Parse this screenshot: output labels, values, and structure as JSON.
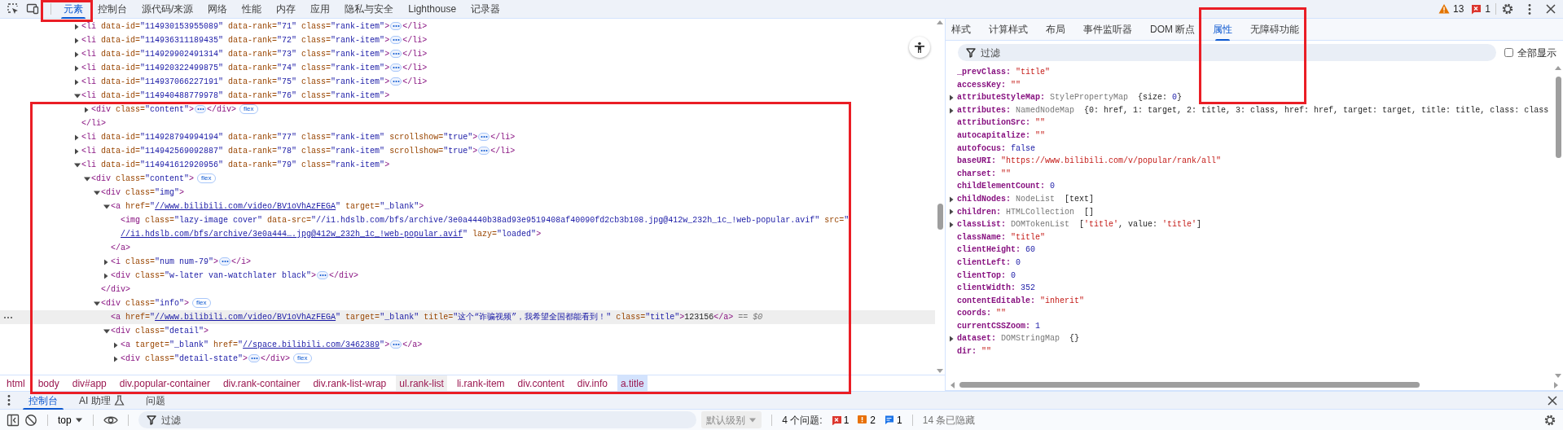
{
  "main_tabs": [
    {
      "label": "元素",
      "selected": true
    },
    {
      "label": "控制台",
      "selected": false
    },
    {
      "label": "源代码/来源",
      "selected": false
    },
    {
      "label": "网络",
      "selected": false
    },
    {
      "label": "性能",
      "selected": false
    },
    {
      "label": "内存",
      "selected": false
    },
    {
      "label": "应用",
      "selected": false
    },
    {
      "label": "隐私与安全",
      "selected": false
    },
    {
      "label": "Lighthouse",
      "selected": false
    },
    {
      "label": "记录器",
      "selected": false
    }
  ],
  "top_counts": {
    "warnings": "13",
    "errors": "1"
  },
  "dom_tree": [
    {
      "selected": false,
      "expanded": false,
      "tokens": [
        {
          "kind": "tag",
          "text": "<li"
        },
        {
          "kind": "attr",
          "text": " data-id="
        },
        {
          "kind": "value",
          "text": "\"114930153955089\""
        },
        {
          "kind": "attr",
          "text": " data-rank="
        },
        {
          "kind": "value",
          "text": "\"71\""
        },
        {
          "kind": "attr",
          "text": " class="
        },
        {
          "kind": "value",
          "text": "\"rank-item\""
        },
        {
          "kind": "tag",
          "text": ">"
        },
        {
          "kind": "more"
        },
        {
          "kind": "tag",
          "text": "</li>"
        }
      ]
    },
    {
      "selected": false,
      "expanded": false,
      "tokens": [
        {
          "kind": "tag",
          "text": "<li"
        },
        {
          "kind": "attr",
          "text": " data-id="
        },
        {
          "kind": "value",
          "text": "\"114936311189435\""
        },
        {
          "kind": "attr",
          "text": " data-rank="
        },
        {
          "kind": "value",
          "text": "\"72\""
        },
        {
          "kind": "attr",
          "text": " class="
        },
        {
          "kind": "value",
          "text": "\"rank-item\""
        },
        {
          "kind": "tag",
          "text": ">"
        },
        {
          "kind": "more"
        },
        {
          "kind": "tag",
          "text": "</li>"
        }
      ]
    },
    {
      "selected": false,
      "expanded": false,
      "tokens": [
        {
          "kind": "tag",
          "text": "<li"
        },
        {
          "kind": "attr",
          "text": " data-id="
        },
        {
          "kind": "value",
          "text": "\"114929902491314\""
        },
        {
          "kind": "attr",
          "text": " data-rank="
        },
        {
          "kind": "value",
          "text": "\"73\""
        },
        {
          "kind": "attr",
          "text": " class="
        },
        {
          "kind": "value",
          "text": "\"rank-item\""
        },
        {
          "kind": "tag",
          "text": ">"
        },
        {
          "kind": "more"
        },
        {
          "kind": "tag",
          "text": "</li>"
        }
      ]
    },
    {
      "selected": false,
      "expanded": false,
      "tokens": [
        {
          "kind": "tag",
          "text": "<li"
        },
        {
          "kind": "attr",
          "text": " data-id="
        },
        {
          "kind": "value",
          "text": "\"114920322499875\""
        },
        {
          "kind": "attr",
          "text": " data-rank="
        },
        {
          "kind": "value",
          "text": "\"74\""
        },
        {
          "kind": "attr",
          "text": " class="
        },
        {
          "kind": "value",
          "text": "\"rank-item\""
        },
        {
          "kind": "tag",
          "text": ">"
        },
        {
          "kind": "more"
        },
        {
          "kind": "tag",
          "text": "</li>"
        }
      ]
    },
    {
      "selected": false,
      "expanded": false,
      "tokens": [
        {
          "kind": "tag",
          "text": "<li"
        },
        {
          "kind": "attr",
          "text": " data-id="
        },
        {
          "kind": "value",
          "text": "\"114937066227191\""
        },
        {
          "kind": "attr",
          "text": " data-rank="
        },
        {
          "kind": "value",
          "text": "\"75\""
        },
        {
          "kind": "attr",
          "text": " class="
        },
        {
          "kind": "value",
          "text": "\"rank-item\""
        },
        {
          "kind": "tag",
          "text": ">"
        },
        {
          "kind": "more"
        },
        {
          "kind": "tag",
          "text": "</li>"
        }
      ]
    },
    {
      "selected": false,
      "expanded": true,
      "tokens": [
        {
          "kind": "tag",
          "text": "<li"
        },
        {
          "kind": "attr",
          "text": " data-id="
        },
        {
          "kind": "value",
          "text": "\"114940488779978\""
        },
        {
          "kind": "attr",
          "text": " data-rank="
        },
        {
          "kind": "value",
          "text": "\"76\""
        },
        {
          "kind": "attr",
          "text": " class="
        },
        {
          "kind": "value",
          "text": "\"rank-item\""
        },
        {
          "kind": "tag",
          "text": ">"
        }
      ],
      "close": [
        {
          "kind": "tag",
          "text": "</li>"
        }
      ],
      "children": [
        {
          "selected": false,
          "expanded": false,
          "tokens": [
            {
              "kind": "tag",
              "text": "<div"
            },
            {
              "kind": "attr",
              "text": " class="
            },
            {
              "kind": "value",
              "text": "\"content\""
            },
            {
              "kind": "tag",
              "text": ">"
            },
            {
              "kind": "more"
            },
            {
              "kind": "tag",
              "text": "</div>"
            },
            {
              "kind": "flex",
              "text": "flex"
            }
          ]
        }
      ]
    },
    {
      "selected": false,
      "expanded": false,
      "tokens": [
        {
          "kind": "tag",
          "text": "<li"
        },
        {
          "kind": "attr",
          "text": " data-id="
        },
        {
          "kind": "value",
          "text": "\"114928794994194\""
        },
        {
          "kind": "attr",
          "text": " data-rank="
        },
        {
          "kind": "value",
          "text": "\"77\""
        },
        {
          "kind": "attr",
          "text": " class="
        },
        {
          "kind": "value",
          "text": "\"rank-item\""
        },
        {
          "kind": "attr",
          "text": " scrollshow="
        },
        {
          "kind": "value",
          "text": "\"true\""
        },
        {
          "kind": "tag",
          "text": ">"
        },
        {
          "kind": "more"
        },
        {
          "kind": "tag",
          "text": "</li>"
        }
      ]
    },
    {
      "selected": false,
      "expanded": false,
      "tokens": [
        {
          "kind": "tag",
          "text": "<li"
        },
        {
          "kind": "attr",
          "text": " data-id="
        },
        {
          "kind": "value",
          "text": "\"114942569092887\""
        },
        {
          "kind": "attr",
          "text": " data-rank="
        },
        {
          "kind": "value",
          "text": "\"78\""
        },
        {
          "kind": "attr",
          "text": " class="
        },
        {
          "kind": "value",
          "text": "\"rank-item\""
        },
        {
          "kind": "attr",
          "text": " scrollshow="
        },
        {
          "kind": "value",
          "text": "\"true\""
        },
        {
          "kind": "tag",
          "text": ">"
        },
        {
          "kind": "more"
        },
        {
          "kind": "tag",
          "text": "</li>"
        }
      ]
    },
    {
      "selected": false,
      "expanded": true,
      "tokens": [
        {
          "kind": "tag",
          "text": "<li"
        },
        {
          "kind": "attr",
          "text": " data-id="
        },
        {
          "kind": "value",
          "text": "\"114941612920956\""
        },
        {
          "kind": "attr",
          "text": " data-rank="
        },
        {
          "kind": "value",
          "text": "\"79\""
        },
        {
          "kind": "attr",
          "text": " class="
        },
        {
          "kind": "value",
          "text": "\"rank-item\""
        },
        {
          "kind": "tag",
          "text": ">"
        }
      ],
      "children": [
        {
          "selected": false,
          "expanded": true,
          "tokens": [
            {
              "kind": "tag",
              "text": "<div"
            },
            {
              "kind": "attr",
              "text": " class="
            },
            {
              "kind": "value",
              "text": "\"content\""
            },
            {
              "kind": "tag",
              "text": ">"
            },
            {
              "kind": "flex",
              "text": "flex"
            }
          ],
          "children": [
            {
              "selected": false,
              "expanded": true,
              "tokens": [
                {
                  "kind": "tag",
                  "text": "<div"
                },
                {
                  "kind": "attr",
                  "text": " class="
                },
                {
                  "kind": "value",
                  "text": "\"img\""
                },
                {
                  "kind": "tag",
                  "text": ">"
                }
              ],
              "close": [
                {
                  "kind": "tag",
                  "text": "</div>"
                }
              ],
              "children": [
                {
                  "selected": false,
                  "expanded": true,
                  "tokens": [
                    {
                      "kind": "tag",
                      "text": "<a"
                    },
                    {
                      "kind": "attr",
                      "text": " href="
                    },
                    {
                      "kind": "value",
                      "text": "\""
                    },
                    {
                      "kind": "link",
                      "text": "//www.bilibili.com/video/BV1oVhAzFEGA"
                    },
                    {
                      "kind": "value",
                      "text": "\""
                    },
                    {
                      "kind": "attr",
                      "text": " target="
                    },
                    {
                      "kind": "value",
                      "text": "\"_blank\""
                    },
                    {
                      "kind": "tag",
                      "text": ">"
                    }
                  ],
                  "close": [
                    {
                      "kind": "tag",
                      "text": "</a>"
                    }
                  ],
                  "children": [
                    {
                      "selected": false,
                      "tokens": [
                        {
                          "kind": "tag",
                          "text": "<img"
                        },
                        {
                          "kind": "attr",
                          "text": " class="
                        },
                        {
                          "kind": "value",
                          "text": "\"lazy-image cover\""
                        },
                        {
                          "kind": "attr",
                          "text": " data-src="
                        },
                        {
                          "kind": "value",
                          "text": "\"//i1.hdslb.com/bfs/archive/3e0a4440b38ad93e9519408af40090fd2cb3b108.jpg@412w_232h_1c_!web-popular.avif\""
                        },
                        {
                          "kind": "attr",
                          "text": " src="
                        },
                        {
                          "kind": "value",
                          "text": "\""
                        },
                        {
                          "kind": "link",
                          "text": "//i1.hdslb.com/bfs/archive/3e0a444….jpg@412w_232h_1c_!web-popular.avif"
                        },
                        {
                          "kind": "value",
                          "text": "\""
                        },
                        {
                          "kind": "attr",
                          "text": " lazy="
                        },
                        {
                          "kind": "value",
                          "text": "\"loaded\""
                        },
                        {
                          "kind": "tag",
                          "text": ">"
                        }
                      ]
                    }
                  ]
                },
                {
                  "selected": false,
                  "expanded": false,
                  "tokens": [
                    {
                      "kind": "tag",
                      "text": "<i"
                    },
                    {
                      "kind": "attr",
                      "text": " class="
                    },
                    {
                      "kind": "value",
                      "text": "\"num num-79\""
                    },
                    {
                      "kind": "tag",
                      "text": ">"
                    },
                    {
                      "kind": "more"
                    },
                    {
                      "kind": "tag",
                      "text": "</i>"
                    }
                  ]
                },
                {
                  "selected": false,
                  "expanded": false,
                  "tokens": [
                    {
                      "kind": "tag",
                      "text": "<div"
                    },
                    {
                      "kind": "attr",
                      "text": " class="
                    },
                    {
                      "kind": "value",
                      "text": "\"w-later van-watchlater black\""
                    },
                    {
                      "kind": "tag",
                      "text": ">"
                    },
                    {
                      "kind": "more"
                    },
                    {
                      "kind": "tag",
                      "text": "</div>"
                    }
                  ]
                }
              ]
            },
            {
              "selected": false,
              "expanded": true,
              "tokens": [
                {
                  "kind": "tag",
                  "text": "<div"
                },
                {
                  "kind": "attr",
                  "text": " class="
                },
                {
                  "kind": "value",
                  "text": "\"info\""
                },
                {
                  "kind": "tag",
                  "text": ">"
                },
                {
                  "kind": "flex",
                  "text": "flex"
                }
              ],
              "children": [
                {
                  "selected": true,
                  "tokens": [
                    {
                      "kind": "tag",
                      "text": "<a"
                    },
                    {
                      "kind": "attr",
                      "text": " href="
                    },
                    {
                      "kind": "value",
                      "text": "\""
                    },
                    {
                      "kind": "link",
                      "text": "//www.bilibili.com/video/BV1oVhAzFEGA"
                    },
                    {
                      "kind": "value",
                      "text": "\""
                    },
                    {
                      "kind": "attr",
                      "text": " target="
                    },
                    {
                      "kind": "value",
                      "text": "\"_blank\""
                    },
                    {
                      "kind": "attr",
                      "text": " title="
                    },
                    {
                      "kind": "value",
                      "text": "\"这个“诈骗视频”，我希望全国都能看到！\""
                    },
                    {
                      "kind": "attr",
                      "text": " class="
                    },
                    {
                      "kind": "value",
                      "text": "\"title\""
                    },
                    {
                      "kind": "tag",
                      "text": ">"
                    },
                    {
                      "kind": "text",
                      "text": "123156"
                    },
                    {
                      "kind": "tag",
                      "text": "</a>"
                    },
                    {
                      "kind": "note",
                      "text": " == $0"
                    }
                  ]
                },
                {
                  "selected": false,
                  "expanded": true,
                  "tokens": [
                    {
                      "kind": "tag",
                      "text": "<div"
                    },
                    {
                      "kind": "attr",
                      "text": " class="
                    },
                    {
                      "kind": "value",
                      "text": "\"detail\""
                    },
                    {
                      "kind": "tag",
                      "text": ">"
                    }
                  ],
                  "children": [
                    {
                      "selected": false,
                      "expanded": false,
                      "tokens": [
                        {
                          "kind": "tag",
                          "text": "<a"
                        },
                        {
                          "kind": "attr",
                          "text": " target="
                        },
                        {
                          "kind": "value",
                          "text": "\"_blank\""
                        },
                        {
                          "kind": "attr",
                          "text": " href="
                        },
                        {
                          "kind": "value",
                          "text": "\""
                        },
                        {
                          "kind": "link",
                          "text": "//space.bilibili.com/3462389"
                        },
                        {
                          "kind": "value",
                          "text": "\""
                        },
                        {
                          "kind": "tag",
                          "text": ">"
                        },
                        {
                          "kind": "more"
                        },
                        {
                          "kind": "tag",
                          "text": "</a>"
                        }
                      ]
                    },
                    {
                      "selected": false,
                      "expanded": false,
                      "tokens": [
                        {
                          "kind": "tag",
                          "text": "<div"
                        },
                        {
                          "kind": "attr",
                          "text": " class="
                        },
                        {
                          "kind": "value",
                          "text": "\"detail-state\""
                        },
                        {
                          "kind": "tag",
                          "text": ">"
                        },
                        {
                          "kind": "more"
                        },
                        {
                          "kind": "tag",
                          "text": "</div>"
                        },
                        {
                          "kind": "flex",
                          "text": "flex"
                        }
                      ]
                    }
                  ]
                }
              ]
            }
          ]
        }
      ]
    }
  ],
  "breadcrumbs": [
    {
      "label": "html",
      "selected": false,
      "hovered": false
    },
    {
      "label": "body",
      "selected": false,
      "hovered": false
    },
    {
      "label": "div#app",
      "selected": false,
      "hovered": false
    },
    {
      "label": "div.popular-container",
      "selected": false,
      "hovered": false
    },
    {
      "label": "div.rank-container",
      "selected": false,
      "hovered": false
    },
    {
      "label": "div.rank-list-wrap",
      "selected": false,
      "hovered": false
    },
    {
      "label": "ul.rank-list",
      "selected": false,
      "hovered": true
    },
    {
      "label": "li.rank-item",
      "selected": false,
      "hovered": false
    },
    {
      "label": "div.content",
      "selected": false,
      "hovered": false
    },
    {
      "label": "div.info",
      "selected": false,
      "hovered": false
    },
    {
      "label": "a.title",
      "selected": true,
      "hovered": false
    }
  ],
  "side_tabs": [
    {
      "label": "样式",
      "selected": false
    },
    {
      "label": "计算样式",
      "selected": false
    },
    {
      "label": "布局",
      "selected": false
    },
    {
      "label": "事件监听器",
      "selected": false
    },
    {
      "label": "DOM 断点",
      "selected": false
    },
    {
      "label": "属性",
      "selected": true
    },
    {
      "label": "无障碍功能",
      "selected": false
    }
  ],
  "side_filter": {
    "placeholder": "过滤"
  },
  "show_all": {
    "label": "全部显示",
    "checked": false
  },
  "properties": [
    {
      "name": "_prevClass:",
      "expandable": false,
      "value": [
        {
          "kind": "string",
          "text": "\"title\""
        }
      ]
    },
    {
      "name": "accessKey:",
      "expandable": false,
      "value": [
        {
          "kind": "string",
          "text": "\"\""
        }
      ]
    },
    {
      "name": "attributeStyleMap:",
      "expandable": true,
      "value": [
        {
          "kind": "type",
          "text": "StylePropertyMap"
        },
        {
          "kind": "text",
          "text": "  {size: "
        },
        {
          "kind": "number",
          "text": "0"
        },
        {
          "kind": "text",
          "text": "}"
        }
      ]
    },
    {
      "name": "attributes:",
      "expandable": true,
      "value": [
        {
          "kind": "type",
          "text": "NamedNodeMap"
        },
        {
          "kind": "text",
          "text": "  {0: href, 1: target, 2: title, 3: class, href: href, target: target, title: title, class: class"
        }
      ]
    },
    {
      "name": "attributionSrc:",
      "expandable": false,
      "value": [
        {
          "kind": "string",
          "text": "\"\""
        }
      ]
    },
    {
      "name": "autocapitalize:",
      "expandable": false,
      "value": [
        {
          "kind": "string",
          "text": "\"\""
        }
      ]
    },
    {
      "name": "autofocus:",
      "expandable": false,
      "value": [
        {
          "kind": "number",
          "text": "false"
        }
      ]
    },
    {
      "name": "baseURI:",
      "expandable": false,
      "value": [
        {
          "kind": "string",
          "text": "\"https://www.bilibili.com/v/popular/rank/all\""
        }
      ]
    },
    {
      "name": "charset:",
      "expandable": false,
      "value": [
        {
          "kind": "string",
          "text": "\"\""
        }
      ]
    },
    {
      "name": "childElementCount:",
      "expandable": false,
      "value": [
        {
          "kind": "number",
          "text": "0"
        }
      ]
    },
    {
      "name": "childNodes:",
      "expandable": true,
      "value": [
        {
          "kind": "type",
          "text": "NodeList"
        },
        {
          "kind": "text",
          "text": "  [text]"
        }
      ]
    },
    {
      "name": "children:",
      "expandable": true,
      "value": [
        {
          "kind": "type",
          "text": "HTMLCollection"
        },
        {
          "kind": "text",
          "text": "  []"
        }
      ]
    },
    {
      "name": "classList:",
      "expandable": true,
      "value": [
        {
          "kind": "type",
          "text": "DOMTokenList"
        },
        {
          "kind": "text",
          "text": "  ["
        },
        {
          "kind": "string",
          "text": "'title'"
        },
        {
          "kind": "text",
          "text": ", value: "
        },
        {
          "kind": "string",
          "text": "'title'"
        },
        {
          "kind": "text",
          "text": "]"
        }
      ]
    },
    {
      "name": "className:",
      "expandable": false,
      "value": [
        {
          "kind": "string",
          "text": "\"title\""
        }
      ]
    },
    {
      "name": "clientHeight:",
      "expandable": false,
      "value": [
        {
          "kind": "number",
          "text": "60"
        }
      ]
    },
    {
      "name": "clientLeft:",
      "expandable": false,
      "value": [
        {
          "kind": "number",
          "text": "0"
        }
      ]
    },
    {
      "name": "clientTop:",
      "expandable": false,
      "value": [
        {
          "kind": "number",
          "text": "0"
        }
      ]
    },
    {
      "name": "clientWidth:",
      "expandable": false,
      "value": [
        {
          "kind": "number",
          "text": "352"
        }
      ]
    },
    {
      "name": "contentEditable:",
      "expandable": false,
      "value": [
        {
          "kind": "string",
          "text": "\"inherit\""
        }
      ]
    },
    {
      "name": "coords:",
      "expandable": false,
      "value": [
        {
          "kind": "string",
          "text": "\"\""
        }
      ]
    },
    {
      "name": "currentCSSZoom:",
      "expandable": false,
      "value": [
        {
          "kind": "number",
          "text": "1"
        }
      ]
    },
    {
      "name": "dataset:",
      "expandable": true,
      "value": [
        {
          "kind": "type",
          "text": "DOMStringMap"
        },
        {
          "kind": "text",
          "text": "  {}"
        }
      ]
    },
    {
      "name": "dir:",
      "expandable": false,
      "value": [
        {
          "kind": "string",
          "text": "\"\""
        }
      ]
    }
  ],
  "drawer_tabs": [
    {
      "label": "控制台",
      "selected": true,
      "kind": "plain"
    },
    {
      "label": "AI 助理",
      "selected": false,
      "kind": "experimental"
    },
    {
      "label": "问题",
      "selected": false,
      "kind": "plain"
    }
  ],
  "console_toolbar": {
    "context": "top",
    "filter": {
      "placeholder": "过滤"
    },
    "level": {
      "label": "默认级别",
      "disabled": true
    },
    "issues_label": "4 个问题:",
    "issue_counts": {
      "errors": "1",
      "warnings": "2",
      "infos": "1"
    },
    "hidden": "14 条已隐藏"
  },
  "annotations": [
    {
      "kind": "box"
    },
    {
      "kind": "box"
    },
    {
      "kind": "box"
    }
  ]
}
